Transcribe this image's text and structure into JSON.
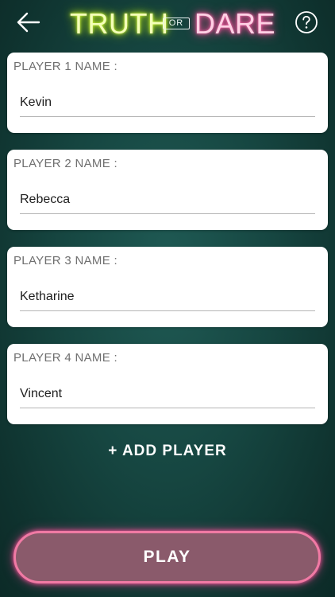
{
  "header": {
    "logo_truth": "TRUTH",
    "logo_or": "OR",
    "logo_dare": "DARE",
    "back_icon": "arrow-left-icon",
    "help_icon": "question-circle-icon"
  },
  "players": [
    {
      "label": "PLAYER 1 NAME :",
      "value": "Kevin"
    },
    {
      "label": "PLAYER 2 NAME :",
      "value": "Rebecca"
    },
    {
      "label": "PLAYER 3 NAME :",
      "value": "Ketharine"
    },
    {
      "label": "PLAYER 4 NAME :",
      "value": "Vincent"
    }
  ],
  "add_player_label": "+ ADD PLAYER",
  "play_label": "PLAY",
  "colors": {
    "background": "#164641",
    "truth_neon": "#d8ff3a",
    "dare_neon": "#ff4f9c",
    "play_fill": "#8a5a6b",
    "play_border": "#f07aa4"
  }
}
